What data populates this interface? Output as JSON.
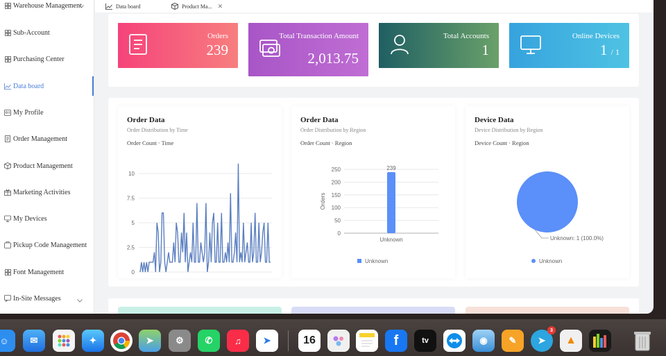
{
  "sidebar": {
    "items": [
      {
        "label": "Warehouse Management",
        "icon": "grid-icon"
      },
      {
        "label": "Sub-Account",
        "icon": "grid-icon"
      },
      {
        "label": "Purchasing Center",
        "icon": "grid-icon"
      },
      {
        "label": "Data board",
        "icon": "line-chart-icon",
        "active": true
      },
      {
        "label": "My Profile",
        "icon": "user-card-icon"
      },
      {
        "label": "Order Management",
        "icon": "document-icon"
      },
      {
        "label": "Product Management",
        "icon": "box-icon"
      },
      {
        "label": "Marketing Activities",
        "icon": "gift-icon"
      },
      {
        "label": "My Devices",
        "icon": "device-icon"
      },
      {
        "label": "Pickup Code Management",
        "icon": "package-icon"
      },
      {
        "label": "Font Management",
        "icon": "grid-icon"
      },
      {
        "label": "In-Site Messages",
        "icon": "message-icon"
      }
    ]
  },
  "tabs": [
    {
      "label": "Data board",
      "icon": "line-chart-icon"
    },
    {
      "label": "Product Ma...",
      "icon": "box-icon",
      "close": "✕"
    }
  ],
  "stats": [
    {
      "label": "Orders",
      "value": "239",
      "colors": [
        "#f6437a",
        "#f77e7f"
      ]
    },
    {
      "label": "Total Transaction Amount",
      "value": "2,013.75",
      "colors": [
        "#a855c7",
        "#c06ed4"
      ]
    },
    {
      "label": "Total Accounts",
      "value": "1",
      "colors": [
        "#1f5f63",
        "#6aa16a"
      ]
    },
    {
      "label": "Online Devices",
      "value": "1",
      "sub": "/ 1",
      "colors": [
        "#36a3de",
        "#4fc3e3"
      ]
    }
  ],
  "charts": [
    {
      "title": "Order Data",
      "subtitle": "Order Distribution by Time",
      "metric": "Order Count · Time",
      "chart_data": {
        "type": "line",
        "ylim": [
          0,
          10
        ],
        "yticks": [
          "10",
          "7.5",
          "5",
          "2.5",
          "0"
        ],
        "series": [
          {
            "values": [
              0,
              1,
              0,
              1,
              0,
              1,
              0,
              1,
              1,
              1,
              1,
              2,
              0,
              5,
              4,
              0,
              1,
              6,
              6,
              1,
              0,
              1,
              2,
              1,
              1,
              1,
              3,
              1,
              5,
              4,
              1,
              1,
              4,
              2,
              6,
              1,
              4,
              0,
              1,
              2,
              1,
              5,
              1,
              1,
              7,
              1,
              1,
              3,
              2,
              1,
              2,
              7,
              0,
              1,
              4,
              1,
              5,
              6,
              1,
              1,
              5,
              1,
              1,
              6,
              1,
              1,
              2,
              1,
              3,
              1,
              8,
              1,
              1,
              2,
              4,
              1,
              11,
              1,
              2,
              1,
              5,
              1,
              2,
              3,
              1,
              1,
              5,
              1,
              2,
              6,
              1,
              1,
              5,
              1,
              2,
              4,
              5,
              1,
              1,
              5,
              1,
              1
            ]
          }
        ],
        "color": "#5b7fc0"
      }
    },
    {
      "title": "Order Data",
      "subtitle": "Order Distribution by Region",
      "metric": "Order Count · Region",
      "chart_data": {
        "type": "bar",
        "categories": [
          "Unknown"
        ],
        "values": [
          239
        ],
        "ylim": [
          0,
          250
        ],
        "yticks": [
          "250",
          "200",
          "150",
          "100",
          "50",
          "0"
        ],
        "ylabel": "Orders",
        "legend": "Unknown",
        "data_label": "239",
        "color": "#5b8ff9"
      }
    },
    {
      "title": "Device Data",
      "subtitle": "Device Distribution by Region",
      "metric": "Device Count · Region",
      "chart_data": {
        "type": "pie",
        "categories": [
          "Unknown"
        ],
        "values": [
          1
        ],
        "slice_label": "Unknown: 1 (100.0%)",
        "legend": "Unknown",
        "color": "#5b8ff9"
      }
    }
  ],
  "dock": {
    "calendar_day": "16",
    "tv_label": "tv",
    "telegram_badge": "3"
  }
}
